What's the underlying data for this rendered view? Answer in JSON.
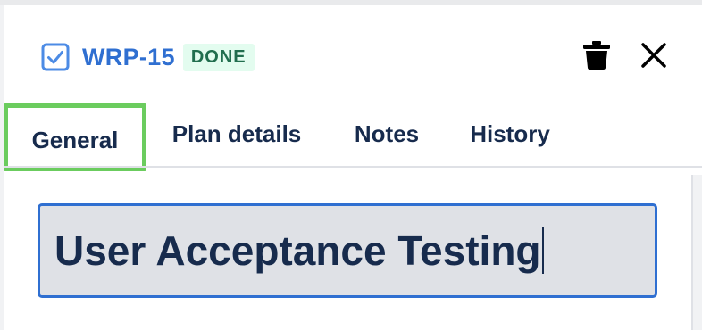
{
  "header": {
    "issue_key": "WRP-15",
    "status": "DONE",
    "checkbox_icon": "checkbox-icon",
    "delete_icon": "trash-icon",
    "close_icon": "close-icon"
  },
  "tabs": [
    {
      "label": "General",
      "selected": true
    },
    {
      "label": "Plan details",
      "selected": false
    },
    {
      "label": "Notes",
      "selected": false
    },
    {
      "label": "History",
      "selected": false
    }
  ],
  "summary": {
    "value": "User Acceptance Testing"
  },
  "colors": {
    "accent": "#2f6fd1",
    "status_bg": "#e3fcef",
    "status_text": "#216e4e",
    "selected_tab_outline": "#6bcc5e",
    "field_bg": "#dfe1e6"
  }
}
